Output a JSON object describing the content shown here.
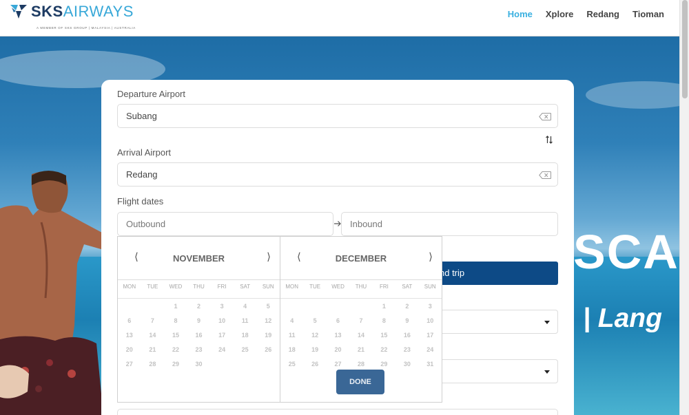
{
  "header": {
    "logo_sks": "SKS",
    "logo_airways": "AIRWAYS",
    "tagline": "A MEMBER OF SKS GROUP | MALAYSIA | AUSTRALIA",
    "nav": [
      "Home",
      "Xplore",
      "Redang",
      "Tioman"
    ],
    "active_nav": "Home"
  },
  "hero": {
    "line1": "SCA",
    "line2": "| Lang"
  },
  "form": {
    "departure_label": "Departure Airport",
    "departure_value": "Subang",
    "arrival_label": "Arrival Airport",
    "arrival_value": "Redang",
    "dates_label": "Flight dates",
    "outbound_placeholder": "Outbound",
    "inbound_placeholder": "Inbound",
    "trip_button": "nd trip"
  },
  "calendar": {
    "days_of_week": [
      "MON",
      "TUE",
      "WED",
      "THU",
      "FRI",
      "SAT",
      "SUN"
    ],
    "months": [
      {
        "name": "NOVEMBER",
        "weeks": [
          [
            "",
            "",
            "1",
            "2",
            "3",
            "4",
            "5"
          ],
          [
            "6",
            "7",
            "8",
            "9",
            "10",
            "11",
            "12"
          ],
          [
            "13",
            "14",
            "15",
            "16",
            "17",
            "18",
            "19"
          ],
          [
            "20",
            "21",
            "22",
            "23",
            "24",
            "25",
            "26"
          ],
          [
            "27",
            "28",
            "29",
            "30",
            "",
            "",
            ""
          ]
        ]
      },
      {
        "name": "DECEMBER",
        "weeks": [
          [
            "",
            "",
            "",
            "",
            "1",
            "2",
            "3"
          ],
          [
            "4",
            "5",
            "6",
            "7",
            "8",
            "9",
            "10"
          ],
          [
            "11",
            "12",
            "13",
            "14",
            "15",
            "16",
            "17"
          ],
          [
            "18",
            "19",
            "20",
            "21",
            "22",
            "23",
            "24"
          ],
          [
            "25",
            "26",
            "27",
            "28",
            "29",
            "30",
            "31"
          ]
        ]
      }
    ],
    "done_label": "DONE"
  },
  "colors": {
    "brand_dark": "#1d3b63",
    "brand_light": "#38a8d8",
    "nav_active": "#3ab0e0",
    "primary_button": "#0d4a86",
    "done_button": "#3a6796"
  }
}
